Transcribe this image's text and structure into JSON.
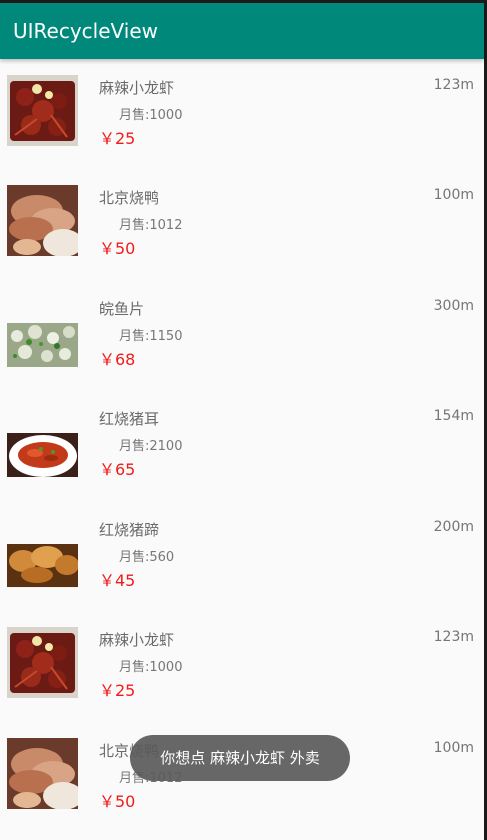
{
  "app": {
    "title": "UIRecycleView"
  },
  "items": [
    {
      "name": "麻辣小龙虾",
      "sales": "月售:1000",
      "price": "￥25",
      "distance": "123m",
      "image": "crayfish-photo"
    },
    {
      "name": "北京烧鸭",
      "sales": "月售:1012",
      "price": "￥50",
      "distance": "100m",
      "image": "roast-duck-photo"
    },
    {
      "name": "皖鱼片",
      "sales": "月售:1150",
      "price": "￥68",
      "distance": "300m",
      "image": "fish-slices-photo"
    },
    {
      "name": "红烧猪耳",
      "sales": "月售:2100",
      "price": "￥65",
      "distance": "154m",
      "image": "braised-pig-ear-photo"
    },
    {
      "name": "红烧猪蹄",
      "sales": "月售:560",
      "price": "￥45",
      "distance": "200m",
      "image": "braised-trotter-photo"
    },
    {
      "name": "麻辣小龙虾",
      "sales": "月售:1000",
      "price": "￥25",
      "distance": "123m",
      "image": "crayfish-photo"
    },
    {
      "name": "北京烧鸭",
      "sales": "月售:1012",
      "price": "￥50",
      "distance": "100m",
      "image": "roast-duck-photo"
    }
  ],
  "toast": {
    "text": "你想点 麻辣小龙虾 外卖"
  },
  "colors": {
    "appbar": "#00897b",
    "price": "#f21b1b",
    "background": "#fafafa"
  }
}
